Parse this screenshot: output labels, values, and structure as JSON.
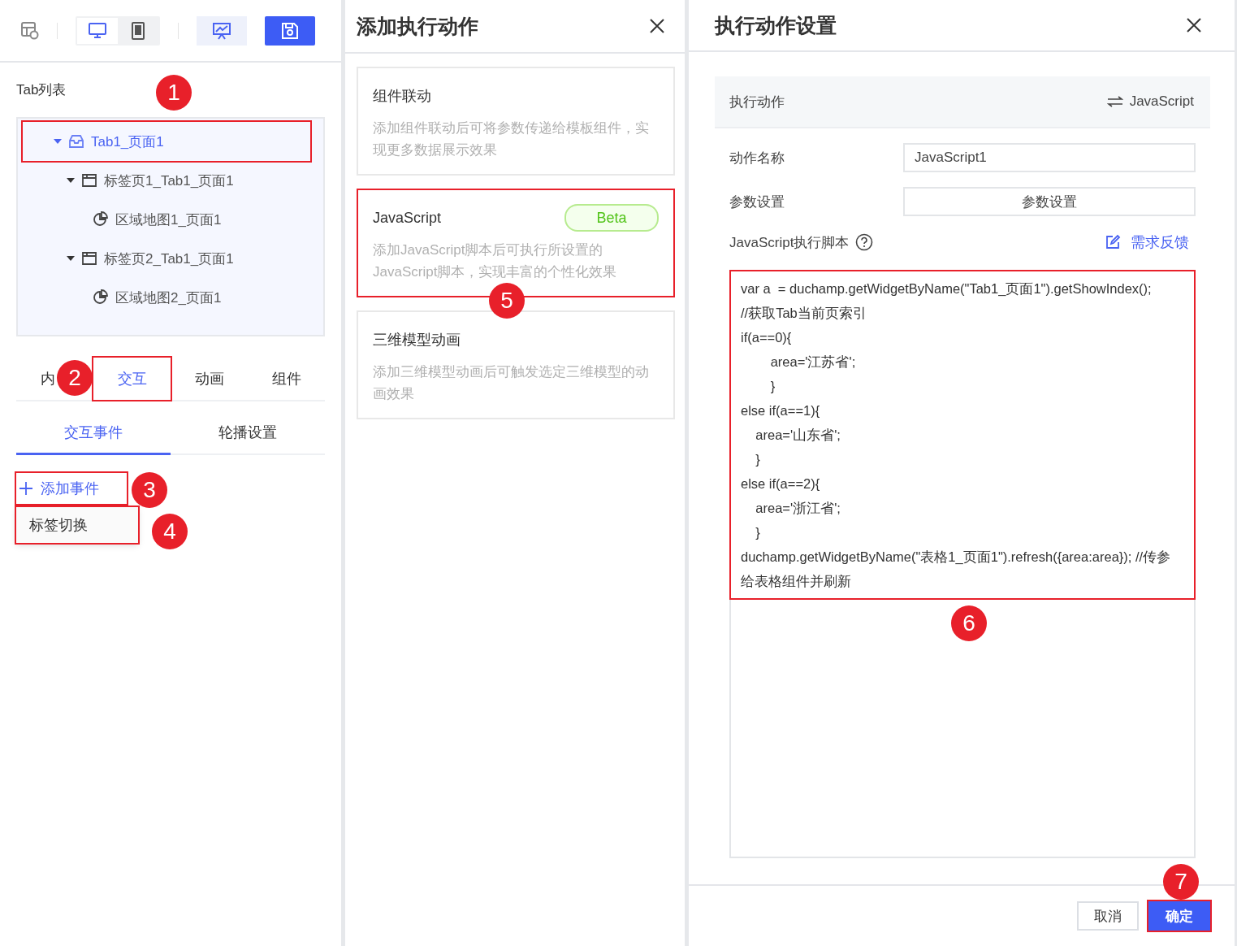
{
  "left_panel": {
    "toolbar": {
      "view_modes": [
        {
          "kind": "desktop",
          "selected": true
        },
        {
          "kind": "tablet",
          "selected": false
        }
      ],
      "save_selected": true
    },
    "tab_list": {
      "title": "Tab列表",
      "tree": [
        {
          "label": "Tab1_页面1",
          "kind": "tab",
          "expanded": true,
          "selected": true,
          "highlighted": true,
          "children": [
            {
              "label": "标签页1_Tab1_页面1",
              "kind": "page",
              "expanded": true,
              "selected": false,
              "highlighted": false,
              "children": [
                {
                  "label": "区域地图1_页面1",
                  "kind": "map",
                  "selected": false,
                  "highlighted": false
                }
              ]
            },
            {
              "label": "标签页2_Tab1_页面1",
              "kind": "page",
              "expanded": true,
              "selected": false,
              "highlighted": false,
              "children": [
                {
                  "label": "区域地图2_页面1",
                  "kind": "map",
                  "selected": false,
                  "highlighted": false
                }
              ]
            }
          ]
        }
      ]
    },
    "tabs": [
      {
        "label": "内",
        "selected": false,
        "highlighted": false
      },
      {
        "label": "交互",
        "selected": true,
        "highlighted": true
      },
      {
        "label": "动画",
        "selected": false,
        "highlighted": false
      },
      {
        "label": "组件",
        "selected": false,
        "highlighted": false
      }
    ],
    "subtabs": [
      {
        "label": "交互事件",
        "selected": true
      },
      {
        "label": "轮播设置",
        "selected": false
      }
    ],
    "add_event": {
      "label": "添加事件",
      "highlighted": true
    },
    "event_menu": [
      {
        "label": "标签切换",
        "highlighted": true
      }
    ]
  },
  "middle_panel": {
    "title": "添加执行动作",
    "cards": [
      {
        "title": "组件联动",
        "description": "添加组件联动后可将参数传递给模板组件，实现更多数据展示效果",
        "highlighted": false
      },
      {
        "title": "JavaScript",
        "badge": "Beta",
        "description": "添加JavaScript脚本后可执行所设置的JavaScript脚本，实现丰富的个性化效果",
        "highlighted": true
      },
      {
        "title": "三维模型动画",
        "description": "添加三维模型动画后可触发选定三维模型的动画效果",
        "highlighted": false
      }
    ]
  },
  "right_panel": {
    "title": "执行动作设置",
    "action_bar": {
      "label": "执行动作",
      "value": "JavaScript"
    },
    "name_field": {
      "label": "动作名称",
      "value": "JavaScript1"
    },
    "params": {
      "label": "参数设置",
      "button": "参数设置"
    },
    "script": {
      "label": "JavaScript执行脚本",
      "feedback_link": "需求反馈",
      "highlighted": true,
      "lines": [
        "var a  = duchamp.getWidgetByName(\"Tab1_页面1\").getShowIndex();",
        "//获取Tab当前页索引",
        "if(a==0){",
        "        area='江苏省';",
        "        }",
        "else if(a==1){",
        "    area='山东省';",
        "    }",
        "else if(a==2){",
        "    area='浙江省';",
        "    }",
        "duchamp.getWidgetByName(\"表格1_页面1\").refresh({area:area}); //传参给表格组件并刷新"
      ]
    },
    "buttons": [
      {
        "label": "取消",
        "kind": "secondary",
        "highlighted": false
      },
      {
        "label": "确定",
        "kind": "primary",
        "highlighted": true
      }
    ]
  },
  "markers": [
    "1",
    "2",
    "3",
    "4",
    "5",
    "6",
    "7"
  ]
}
